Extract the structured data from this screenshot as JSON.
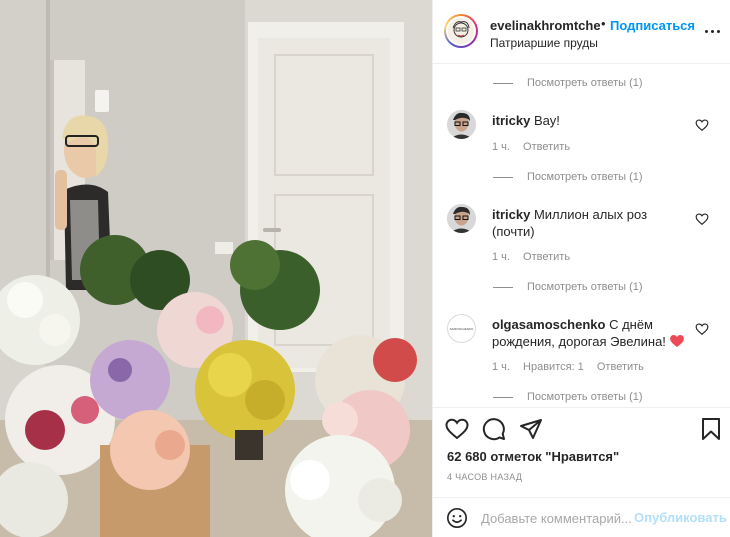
{
  "header": {
    "username": "evelinakhromtchen",
    "separator": "•",
    "follow_label": "Подписаться",
    "location": "Патриаршие пруды"
  },
  "comments": {
    "view_replies_label": "Посмотреть ответы (1)",
    "items": [
      {
        "username": "itricky",
        "text": "Вау!",
        "time": "1 ч.",
        "reply_label": "Ответить"
      },
      {
        "username": "itricky",
        "text": "Миллион алых роз (почти)",
        "time": "1 ч.",
        "reply_label": "Ответить"
      },
      {
        "username": "olgasamoschenko",
        "text": "С днём рождения, дорогая Эвелина!",
        "emoji": "❤️",
        "time": "1 ч.",
        "likes_label": "Нравится: 1",
        "reply_label": "Ответить",
        "avatar_text": "SAMOSCHENKO"
      }
    ]
  },
  "actions": {
    "likes_text": "62 680 отметок \"Нравится\"",
    "time_ago": "4 ЧАСОВ НАЗАД"
  },
  "add_comment": {
    "placeholder": "Добавьте комментарий...",
    "publish_label": "Опубликовать"
  },
  "icons": {
    "like": "heart-icon",
    "comment": "comment-icon",
    "share": "share-icon",
    "save": "bookmark-icon",
    "more": "more-options-icon",
    "emoji": "smiley-icon"
  },
  "colors": {
    "link_blue": "#0095f6",
    "publish_disabled": "#b2dffc",
    "secondary_text": "#8e8e8e",
    "heart_red": "#ed4956"
  }
}
